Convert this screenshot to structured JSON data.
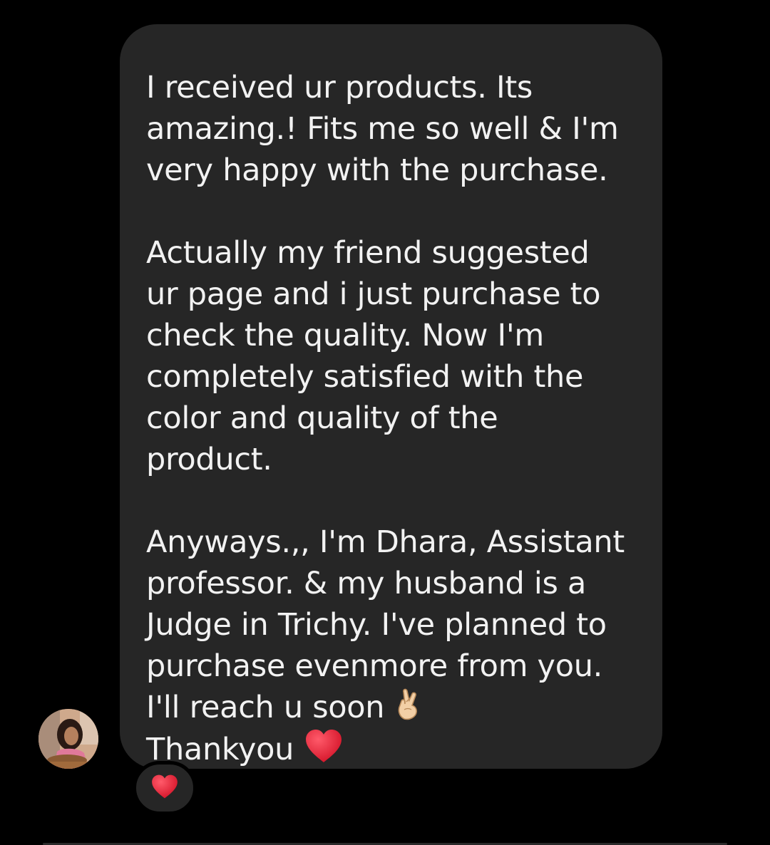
{
  "message": {
    "lines": [
      "I received ur products. Its",
      "amazing.! Fits me so well & I'm",
      "very happy with the purchase.",
      "",
      "Actually my friend suggested",
      "ur page and i just purchase to",
      "check the quality. Now I'm",
      "completely satisfied with the",
      "color and quality of the",
      "product.",
      "",
      "Anyways.,, I'm Dhara, Assistant",
      "professor. & my husband is a",
      "Judge in Trichy. I've planned to",
      "purchase evenmore from you.",
      "I'll reach u soon",
      "Thankyou"
    ],
    "line_emojis": {
      "15": "crossed-fingers-icon",
      "16": "red-heart-icon"
    }
  },
  "reaction": {
    "icon": "red-heart-icon"
  },
  "colors": {
    "background": "#000000",
    "bubble": "#262626",
    "text": "#f2f2f2",
    "heart": "#e0162b",
    "skin": "#f2cfa6"
  }
}
